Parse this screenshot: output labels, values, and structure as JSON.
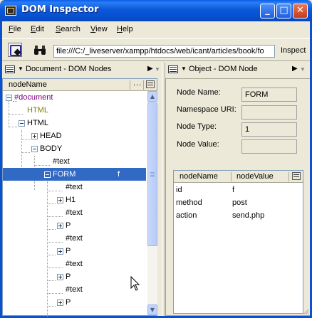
{
  "window": {
    "title": "DOM Inspector",
    "minimize_glyph": "_",
    "maximize_glyph": "□",
    "close_glyph": "✕"
  },
  "menu": {
    "items": [
      {
        "underline": "F",
        "rest": "ile"
      },
      {
        "underline": "E",
        "rest": "dit"
      },
      {
        "underline": "S",
        "rest": "earch"
      },
      {
        "underline": "V",
        "rest": "iew"
      },
      {
        "underline": "H",
        "rest": "elp"
      }
    ]
  },
  "toolbar": {
    "url_value": "file:///C:/_liveserver/xampp/htdocs/web/icant/articles/book/fo",
    "inspect_label": "Inspect",
    "binoculars_glyph": "⛓"
  },
  "left_panel": {
    "title": "Document - DOM Nodes",
    "column_header": "nodeName",
    "column_dots": "...",
    "scroll_up": "▲",
    "scroll_down": "▼",
    "tree": [
      {
        "label": "#document",
        "twisty": "minus",
        "color": "#800080",
        "extra": ""
      },
      {
        "label": "HTML",
        "twisty": "none",
        "color": "#808000",
        "extra": ""
      },
      {
        "label": "HTML",
        "twisty": "minus",
        "color": "#000000",
        "extra": ""
      },
      {
        "label": "HEAD",
        "twisty": "plus",
        "color": "#000000",
        "extra": ""
      },
      {
        "label": "BODY",
        "twisty": "minus",
        "color": "#000000",
        "extra": ""
      },
      {
        "label": "#text",
        "twisty": "none",
        "color": "#000000",
        "extra": ""
      },
      {
        "label": "FORM",
        "twisty": "minus",
        "color": "#ffffff",
        "extra": "f",
        "selected": true
      },
      {
        "label": "#text",
        "twisty": "none",
        "color": "#000000",
        "extra": ""
      },
      {
        "label": "H1",
        "twisty": "plus",
        "color": "#000000",
        "extra": ""
      },
      {
        "label": "#text",
        "twisty": "none",
        "color": "#000000",
        "extra": ""
      },
      {
        "label": "P",
        "twisty": "plus",
        "color": "#000000",
        "extra": ""
      },
      {
        "label": "#text",
        "twisty": "none",
        "color": "#000000",
        "extra": ""
      },
      {
        "label": "P",
        "twisty": "plus",
        "color": "#000000",
        "extra": ""
      },
      {
        "label": "#text",
        "twisty": "none",
        "color": "#000000",
        "extra": ""
      },
      {
        "label": "P",
        "twisty": "plus",
        "color": "#000000",
        "extra": ""
      },
      {
        "label": "#text",
        "twisty": "none",
        "color": "#000000",
        "extra": ""
      },
      {
        "label": "P",
        "twisty": "plus",
        "color": "#000000",
        "extra": ""
      }
    ]
  },
  "right_panel": {
    "title": "Object - DOM Node",
    "node_name_label": "Node Name:",
    "node_name_value": "FORM",
    "namespace_label": "Namespace URI:",
    "namespace_value": "",
    "node_type_label": "Node Type:",
    "node_type_value": "1",
    "node_value_label": "Node Value:",
    "node_value_value": "",
    "attr_headers": {
      "name": "nodeName",
      "value": "nodeValue"
    },
    "attributes": [
      {
        "name": "id",
        "value": "f"
      },
      {
        "name": "method",
        "value": "post"
      },
      {
        "name": "action",
        "value": "send.php"
      }
    ]
  },
  "colors": {
    "titlebar": "#0450d0",
    "selection": "#316ac5",
    "window_bg": "#ece9d8"
  }
}
